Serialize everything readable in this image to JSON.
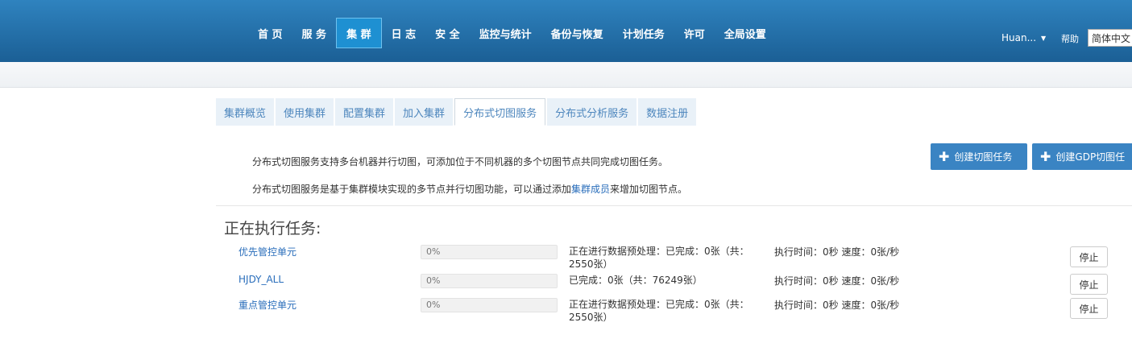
{
  "nav": {
    "items": [
      {
        "label": "首 页",
        "active": false
      },
      {
        "label": "服 务",
        "active": false
      },
      {
        "label": "集 群",
        "active": true
      },
      {
        "label": "日 志",
        "active": false
      },
      {
        "label": "安 全",
        "active": false
      },
      {
        "label": "监控与统计",
        "active": false
      },
      {
        "label": "备份与恢复",
        "active": false
      },
      {
        "label": "计划任务",
        "active": false
      },
      {
        "label": "许可",
        "active": false
      },
      {
        "label": "全局设置",
        "active": false
      }
    ],
    "user": "Huan...",
    "help": "帮助",
    "language": "简体中文"
  },
  "tabs": [
    {
      "label": "集群概览",
      "active": false
    },
    {
      "label": "使用集群",
      "active": false
    },
    {
      "label": "配置集群",
      "active": false
    },
    {
      "label": "加入集群",
      "active": false
    },
    {
      "label": "分布式切图服务",
      "active": true
    },
    {
      "label": "分布式分析服务",
      "active": false
    },
    {
      "label": "数据注册",
      "active": false
    }
  ],
  "description": {
    "line1": "分布式切图服务支持多台机器并行切图，可添加位于不同机器的多个切图节点共同完成切图任务。",
    "line2_prefix": "分布式切图服务是基于集群模块实现的多节点并行切图功能，可以通过添加",
    "line2_link": "集群成员",
    "line2_suffix": "来增加切图节点。"
  },
  "buttons": {
    "create_task": "创建切图任务",
    "create_gdp_task": "创建GDP切图任"
  },
  "section": {
    "title": "正在执行任务:"
  },
  "tasks": [
    {
      "name": "优先管控单元",
      "progress_label": "0%",
      "progress_value": 0,
      "status": "正在进行数据预处理：已完成：0张（共：2550张）",
      "time": "执行时间：0秒 速度：0张/秒",
      "stop_label": "停止"
    },
    {
      "name": "HJDY_ALL",
      "progress_label": "0%",
      "progress_value": 0,
      "status": "已完成：0张（共：76249张）",
      "time": "执行时间：0秒 速度：0张/秒",
      "stop_label": "停止"
    },
    {
      "name": "重点管控单元",
      "progress_label": "0%",
      "progress_value": 0,
      "status": "正在进行数据预处理：已完成：0张（共：2550张）",
      "time": "执行时间：0秒 速度：0张/秒",
      "stop_label": "停止"
    }
  ],
  "colors": {
    "topbar": "#1b5f95",
    "nav_active": "#1e90d2",
    "link": "#2a6ebb",
    "primary_button": "#3a84c3",
    "progress_fill": "#5cb85c"
  }
}
